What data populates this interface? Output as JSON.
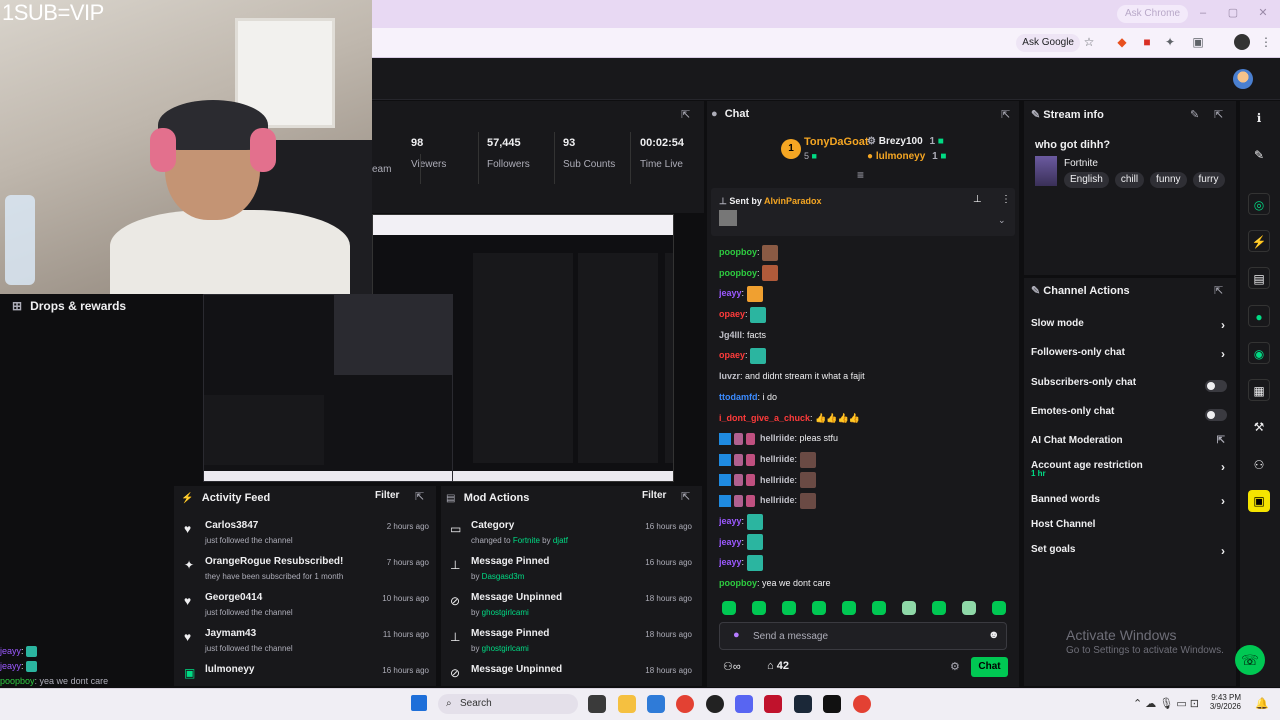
{
  "cam_overlay_text": "1SUB=VIP",
  "browser": {
    "ask_chrome": "Ask Chrome",
    "ask_google": "Ask Google"
  },
  "left_nav": {
    "drops_label": "Drops & rewards"
  },
  "stats": [
    {
      "value": "98",
      "label": "Viewers"
    },
    {
      "value": "57,445",
      "label": "Followers"
    },
    {
      "value": "93",
      "label": "Sub Counts"
    },
    {
      "value": "00:02:54",
      "label": "Time Live"
    }
  ],
  "stats_partial_label": "eam",
  "mini_chat": [
    {
      "user": "jeayy",
      "text": ":"
    },
    {
      "user": "jeayy",
      "text": ":"
    },
    {
      "user": "poopboy",
      "text": ": yea we dont care"
    }
  ],
  "activity": {
    "title": "Activity Feed",
    "filter": "Filter",
    "items": [
      {
        "name": "Carlos3847",
        "sub": "just followed the channel",
        "time": "2 hours ago",
        "icon": "heart-icon"
      },
      {
        "name": "OrangeRogue Resubscribed!",
        "sub": "they have been subscribed for 1 month",
        "time": "7 hours ago",
        "icon": "star-icon"
      },
      {
        "name": "George0414",
        "sub": "just followed the channel",
        "time": "10 hours ago",
        "icon": "heart-icon"
      },
      {
        "name": "Jaymam43",
        "sub": "just followed the channel",
        "time": "11 hours ago",
        "icon": "heart-icon"
      },
      {
        "name": "lulmoneyy",
        "sub": "",
        "time": "16 hours ago",
        "icon": "gift-icon"
      }
    ]
  },
  "mod_actions": {
    "title": "Mod Actions",
    "filter": "Filter",
    "items": [
      {
        "name": "Category",
        "sub_prefix": "changed to ",
        "sub_highlight": "Fortnite",
        "sub_mid": " by ",
        "sub_user": "djatf",
        "time": "16 hours ago"
      },
      {
        "name": "Message Pinned",
        "sub_prefix": "by ",
        "sub_highlight": "",
        "sub_mid": "",
        "sub_user": "Dasgasd3m",
        "time": "16 hours ago"
      },
      {
        "name": "Message Unpinned",
        "sub_prefix": "by ",
        "sub_highlight": "",
        "sub_mid": "",
        "sub_user": "ghostgirlcami",
        "time": "18 hours ago"
      },
      {
        "name": "Message Pinned",
        "sub_prefix": "by ",
        "sub_highlight": "",
        "sub_mid": "",
        "sub_user": "ghostgirlcami",
        "time": "18 hours ago"
      },
      {
        "name": "Message Unpinned",
        "sub_prefix": "",
        "sub_highlight": "",
        "sub_mid": "",
        "sub_user": "",
        "time": "18 hours ago"
      }
    ]
  },
  "chat": {
    "title": "Chat",
    "leaders": [
      {
        "rank": "1",
        "name": "TonyDaGoat",
        "count": "5"
      },
      {
        "rank": "",
        "name": "Brezy100",
        "count": "1"
      },
      {
        "rank": "",
        "name": "lulmoneyy",
        "count": "1"
      }
    ],
    "pinned": {
      "label": "Sent by ",
      "user": "AlvinParadox"
    },
    "messages": [
      {
        "user": "poopboy",
        "color": "#2ecc40",
        "text": "",
        "emote": "#8a5a44"
      },
      {
        "user": "poopboy",
        "color": "#2ecc40",
        "text": "",
        "emote": "#b05a3a"
      },
      {
        "user": "jeayy",
        "color": "#9b59ff",
        "text": "",
        "emote": "#f0a030"
      },
      {
        "user": "opaey",
        "color": "#ff3b3b",
        "text": "",
        "emote": "#2bb5a0"
      },
      {
        "user": "Jg4lll",
        "color": "#c0c0c8",
        "text": "facts",
        "emote": ""
      },
      {
        "user": "opaey",
        "color": "#ff3b3b",
        "text": "",
        "emote": "#2bb5a0"
      },
      {
        "user": "luvzr",
        "color": "#c0c0c8",
        "text": "and didnt stream it what a fajit",
        "emote": ""
      },
      {
        "user": "ttodamfd",
        "color": "#3b8bff",
        "text": "i do",
        "emote": ""
      },
      {
        "user": "i_dont_give_a_chuck",
        "color": "#ff3b3b",
        "text": "👍👍👍👍",
        "emote": ""
      },
      {
        "user": "hellriide",
        "color": "#c0c0c8",
        "text": "pleas stfu",
        "emote": "",
        "badges": true
      },
      {
        "user": "hellriide",
        "color": "#c0c0c8",
        "text": "",
        "emote": "#6a4a44",
        "badges": true
      },
      {
        "user": "hellriide",
        "color": "#c0c0c8",
        "text": "",
        "emote": "#6a4a44",
        "badges": true
      },
      {
        "user": "hellriide",
        "color": "#c0c0c8",
        "text": "",
        "emote": "#6a4a44",
        "badges": true
      },
      {
        "user": "jeayy",
        "color": "#9b59ff",
        "text": "",
        "emote": "#2bb5a0"
      },
      {
        "user": "jeayy",
        "color": "#9b59ff",
        "text": "",
        "emote": "#2bb5a0"
      },
      {
        "user": "jeayy",
        "color": "#9b59ff",
        "text": "",
        "emote": "#2bb5a0"
      },
      {
        "user": "poopboy",
        "color": "#2ecc40",
        "text": "yea we dont care",
        "emote": ""
      }
    ],
    "input_placeholder": "Send a message",
    "viewer_count": "42",
    "chat_button": "Chat"
  },
  "stream_info": {
    "title": "Stream info",
    "stream_title": "who got dihh?",
    "category": "Fortnite",
    "tags": [
      "English",
      "chill",
      "funny",
      "furry"
    ]
  },
  "channel_actions": {
    "title": "Channel Actions",
    "items": [
      {
        "label": "Slow mode",
        "kind": "chevron",
        "sub": ""
      },
      {
        "label": "Followers-only chat",
        "kind": "chevron",
        "sub": ""
      },
      {
        "label": "Subscribers-only chat",
        "kind": "toggle",
        "sub": ""
      },
      {
        "label": "Emotes-only chat",
        "kind": "toggle",
        "sub": ""
      },
      {
        "label": "AI Chat Moderation",
        "kind": "external",
        "sub": ""
      },
      {
        "label": "Account age restriction",
        "kind": "chevron",
        "sub": "1 hr"
      },
      {
        "label": "Banned words",
        "kind": "chevron",
        "sub": ""
      },
      {
        "label": "Host Channel",
        "kind": "none",
        "sub": ""
      },
      {
        "label": "Set goals",
        "kind": "chevron",
        "sub": ""
      }
    ]
  },
  "watermark": {
    "title": "Activate Windows",
    "sub": "Go to Settings to activate Windows."
  },
  "taskbar": {
    "search": "Search",
    "time": "9:43 PM",
    "date": "3/9/2026"
  },
  "colors": {
    "accent": "#00db84",
    "brand_green": "#00c853"
  }
}
